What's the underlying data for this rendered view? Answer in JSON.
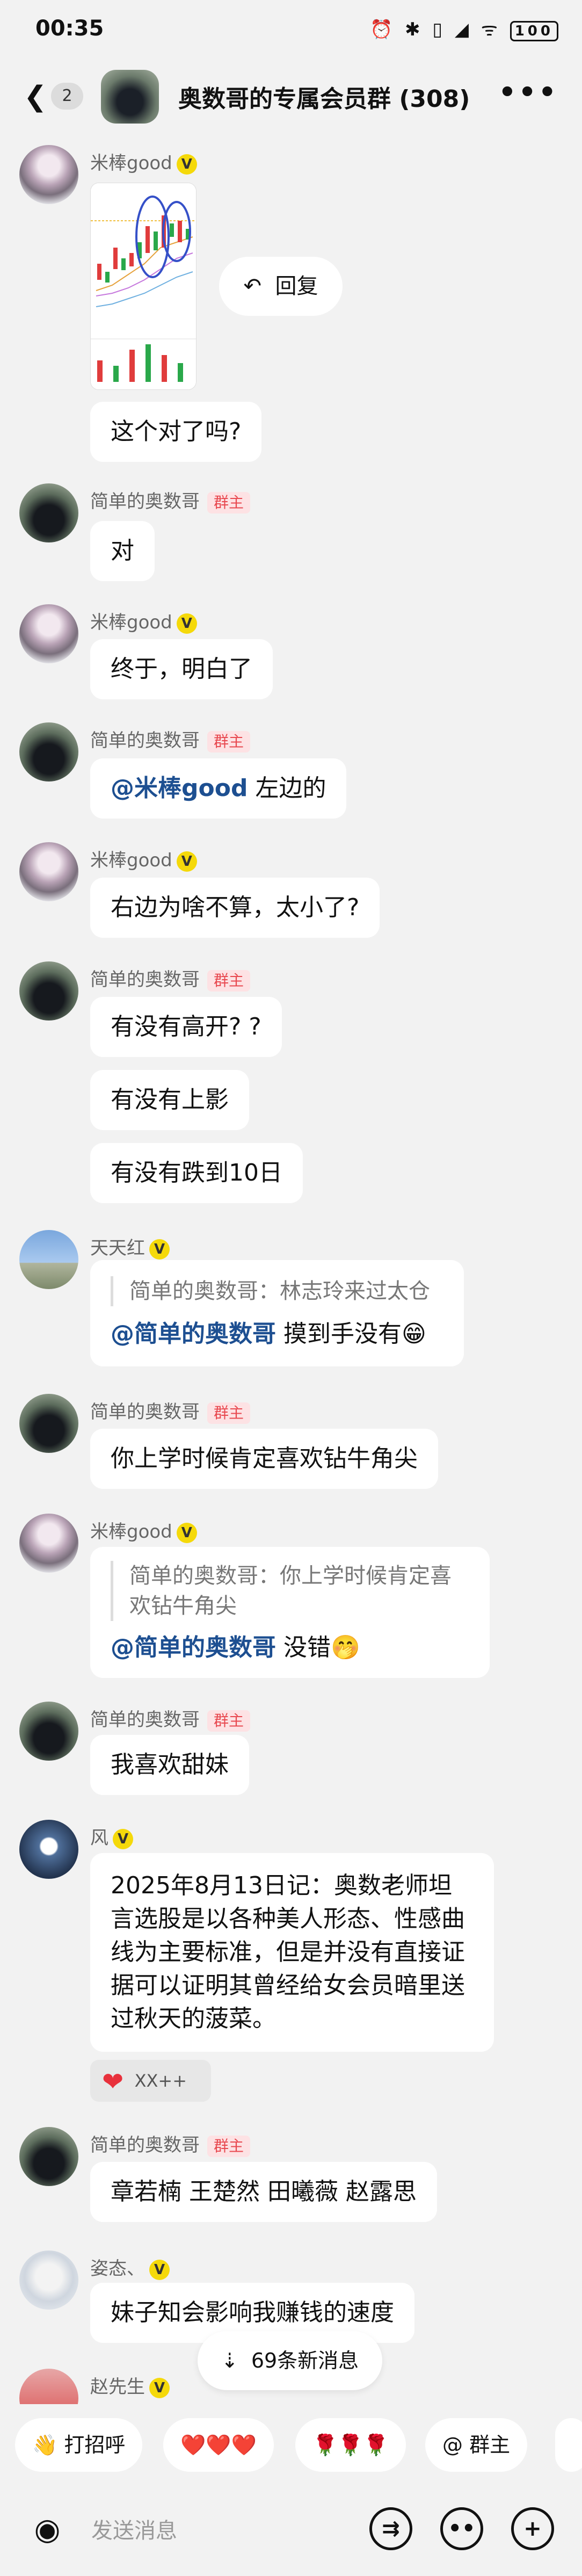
{
  "status_bar": {
    "time": "00:35",
    "icons": "⏰ ✱ ▯ ◢ ᯤ",
    "battery": "100"
  },
  "header": {
    "unread_count": "2",
    "title": "奥数哥的专属会员群 (308)",
    "more": "•••"
  },
  "users": {
    "mi": "米棒good",
    "jd": "简单的奥数哥",
    "tt": "天天红",
    "feng": "风",
    "zi": "姿态、",
    "zhao": "赵先生"
  },
  "badges": {
    "vip": "V",
    "owner": "群主"
  },
  "reply_button": "回复",
  "messages": {
    "m1": "这个对了吗?",
    "m2": "对",
    "m3": "终于，明白了",
    "m4_mention": "@米棒good",
    "m4_text": " 左边的",
    "m5": "右边为啥不算，太小了?",
    "m6": "有没有高开? ?",
    "m7": "有没有上影",
    "m8": "有没有跌到10日",
    "m9_quote": "简单的奥数哥：林志玲来过太仓",
    "m9_mention": "@简单的奥数哥",
    "m9_text": " 摸到手没有😁",
    "m10": "你上学时候肯定喜欢钻牛角尖",
    "m11_quote": "简单的奥数哥：你上学时候肯定喜欢钻牛角尖",
    "m11_mention": "@简单的奥数哥",
    "m11_text": " 没错🤭",
    "m12": "我喜欢甜妹",
    "m13": "2025年8月13日记：奥数老师坦言选股是以各种美人形态、性感曲线为主要标准，但是并没有直接证据可以证明其曾经给女会员暗里送过秋天的菠菜。",
    "m13_reaction": "XX++",
    "m14": "章若楠  王楚然  田曦薇  赵露思",
    "m15": "妹子知会影响我赚钱的速度"
  },
  "new_messages": "69条新消息",
  "quick_chips": {
    "c1": "👋 打招呼",
    "c2": "❤️❤️❤️",
    "c3": "🌹🌹🌹",
    "c4": "@ 群主"
  },
  "input": {
    "placeholder": "发送消息"
  }
}
